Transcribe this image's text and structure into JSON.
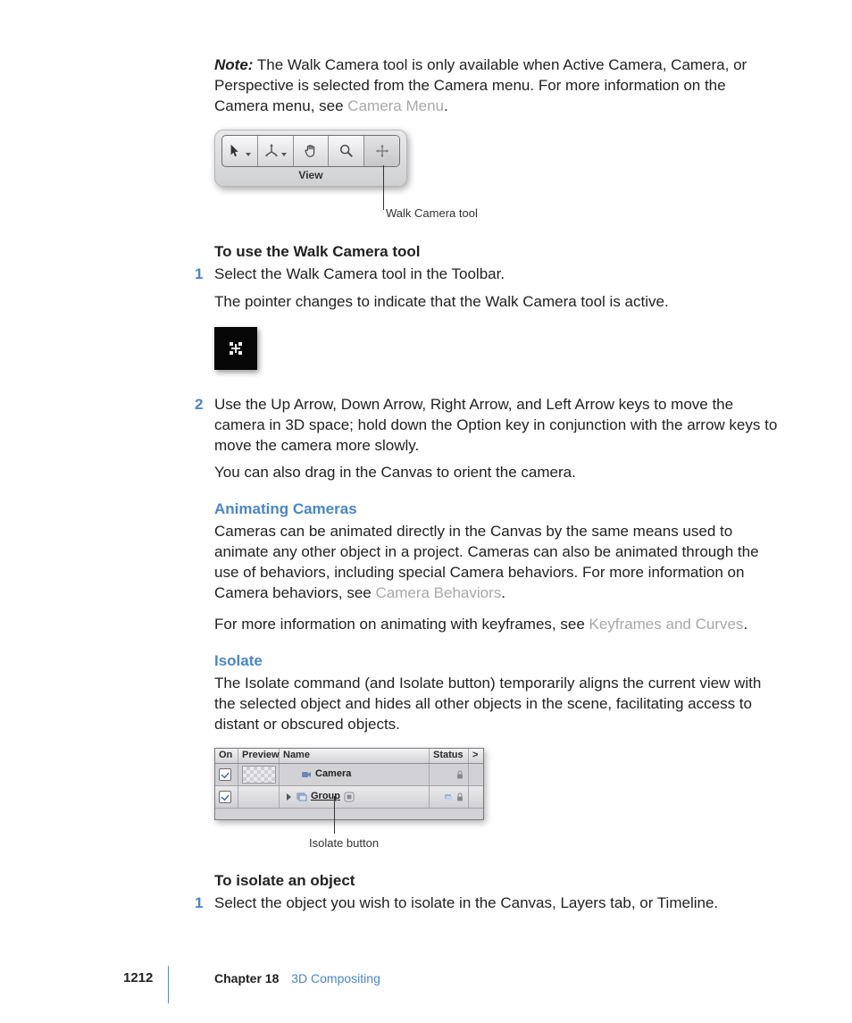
{
  "note": {
    "label": "Note:",
    "text": "The Walk Camera tool is only available when Active Camera, Camera, or Perspective is selected from the Camera menu. For more information on the Camera menu, see ",
    "link": "Camera Menu",
    "after": "."
  },
  "toolbar": {
    "view_label": "View",
    "callout": "Walk Camera tool"
  },
  "walk": {
    "heading": "To use the Walk Camera tool",
    "step1_num": "1",
    "step1": "Select the Walk Camera tool in the Toolbar.",
    "step1_sub": "The pointer changes to indicate that the Walk Camera tool is active.",
    "step2_num": "2",
    "step2": "Use the Up Arrow, Down Arrow, Right Arrow, and Left Arrow keys to move the camera in 3D space; hold down the Option key in conjunction with the arrow keys to move the camera more slowly.",
    "step2_sub": "You can also drag in the Canvas to orient the camera."
  },
  "animating": {
    "heading": "Animating Cameras",
    "p1a": "Cameras can be animated directly in the Canvas by the same means used to animate any other object in a project. Cameras can also be animated through the use of behaviors, including special Camera behaviors. For more information on Camera behaviors, see ",
    "p1_link": "Camera Behaviors",
    "p1b": ".",
    "p2a": "For more information on animating with keyframes, see ",
    "p2_link": "Keyframes and Curves",
    "p2b": "."
  },
  "isolate": {
    "heading": "Isolate",
    "p1": "The Isolate command (and Isolate button) temporarily aligns the current view with the selected object and hides all other objects in the scene, facilitating access to distant or obscured objects.",
    "panel": {
      "col_on": "On",
      "col_preview": "Preview",
      "col_name": "Name",
      "col_status": "Status",
      "col_expand": ">",
      "row1_name": "Camera",
      "row2_name": "Group"
    },
    "callout": "Isolate button",
    "heading2": "To isolate an object",
    "step1_num": "1",
    "step1": "Select the object you wish to isolate in the Canvas, Layers tab, or Timeline."
  },
  "footer": {
    "page": "1212",
    "chapter": "Chapter 18",
    "title": "3D Compositing"
  }
}
